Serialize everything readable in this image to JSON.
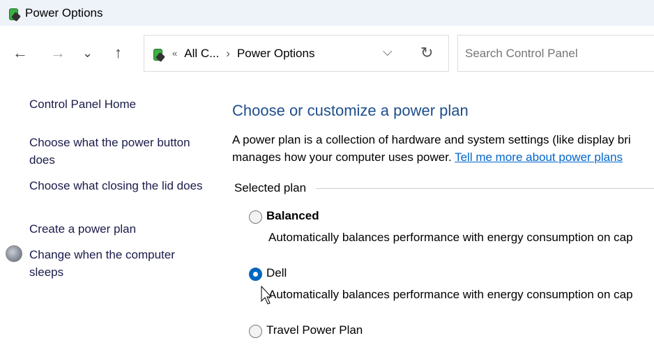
{
  "window": {
    "title": "Power Options"
  },
  "nav": {
    "back": "←",
    "forward": "→",
    "recent": "⌄",
    "up": "↑",
    "breadcrumb_overflow": "«",
    "breadcrumb_parent": "All C...",
    "breadcrumb_sep": "›",
    "breadcrumb_current": "Power Options",
    "dropdown": "⌵",
    "refresh": "↻",
    "search_placeholder": "Search Control Panel"
  },
  "sidebar": {
    "items": [
      {
        "label": "Control Panel Home"
      },
      {
        "label": "Choose what the power button does"
      },
      {
        "label": "Choose what closing the lid does"
      },
      {
        "label": "Create a power plan"
      },
      {
        "label": "Change when the computer sleeps"
      }
    ]
  },
  "main": {
    "title": "Choose or customize a power plan",
    "desc_line1": "A power plan is a collection of hardware and system settings (like display bri",
    "desc_line2": "manages how your computer uses power.",
    "link": "Tell me more about power plans",
    "group_label": "Selected plan",
    "plans": [
      {
        "name": "Balanced",
        "desc": "Automatically balances performance with energy consumption on cap",
        "selected": false
      },
      {
        "name": "Dell",
        "desc": "Automatically balances performance with energy consumption on cap",
        "selected": true
      },
      {
        "name": "Travel Power Plan",
        "selected": false
      }
    ]
  }
}
